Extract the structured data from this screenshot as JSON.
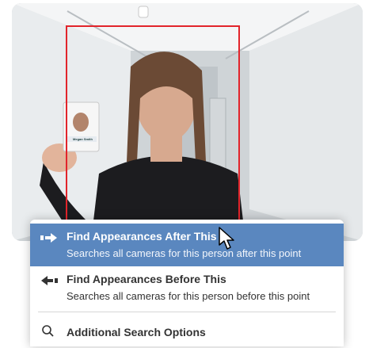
{
  "camera": {
    "badge_name": "Megan Smith"
  },
  "menu": {
    "items": [
      {
        "title": "Find Appearances After This",
        "description": "Searches all cameras for this person after this point",
        "icon": "arrow-right-icon",
        "selected": true
      },
      {
        "title": "Find Appearances Before This",
        "description": "Searches all cameras for this person before this point",
        "icon": "arrow-left-icon",
        "selected": false
      },
      {
        "title": "Additional Search Options",
        "icon": "search-icon",
        "selected": false
      }
    ]
  },
  "colors": {
    "selection": "#5a87bf",
    "detection_box": "#e2242b"
  }
}
